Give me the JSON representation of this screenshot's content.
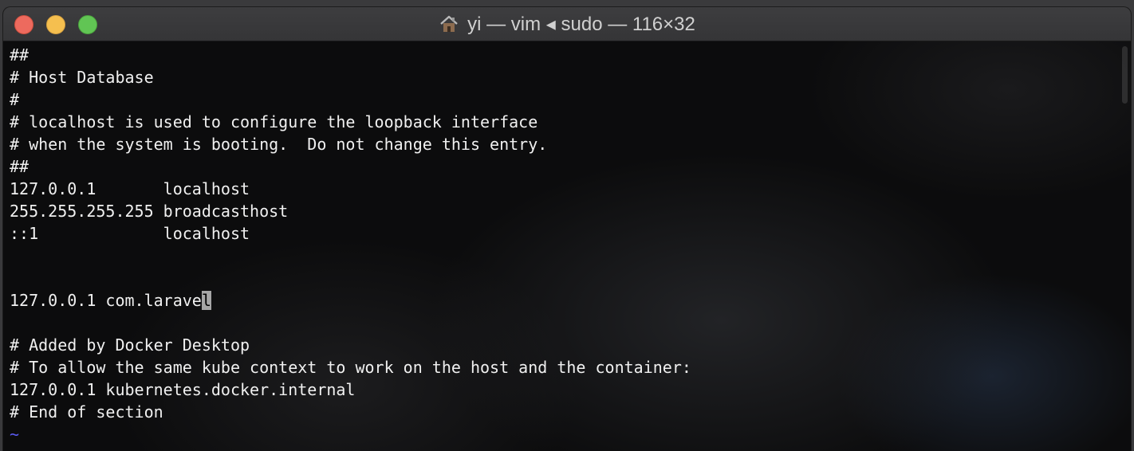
{
  "window": {
    "title": "yi — vim ◂ sudo — 116×32"
  },
  "buffer": {
    "lines": [
      "##",
      "# Host Database",
      "#",
      "# localhost is used to configure the loopback interface",
      "# when the system is booting.  Do not change this entry.",
      "##",
      "127.0.0.1       localhost",
      "255.255.255.255 broadcasthost",
      "::1             localhost",
      "",
      "",
      "127.0.0.1 com.larave",
      "",
      "# Added by Docker Desktop",
      "# To allow the same kube context to work on the host and the container:",
      "127.0.0.1 kubernetes.docker.internal",
      "# End of section"
    ],
    "cursor_char": "l",
    "empty_line_marker": "~"
  },
  "colors": {
    "close": "#ed6a5e",
    "minimize": "#f5bf4f",
    "zoom": "#61c554",
    "cursor": "#a6a6a6",
    "tilde": "#5a5af0",
    "text": "#f0f0f0"
  },
  "icons": {
    "title_icon": "home-icon"
  }
}
